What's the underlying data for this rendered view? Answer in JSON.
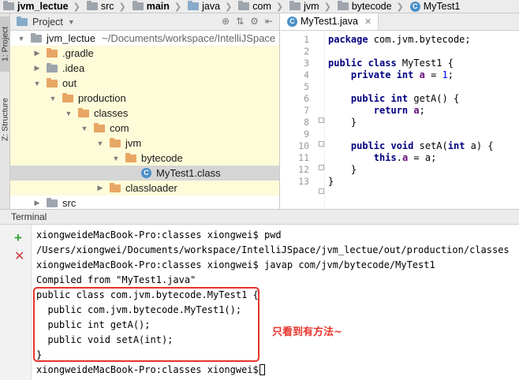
{
  "breadcrumb": {
    "items": [
      {
        "label": "jvm_lectue",
        "bold": true,
        "icon": "folder-gray-icon"
      },
      {
        "label": "src",
        "bold": false,
        "icon": "folder-gray-icon"
      },
      {
        "label": "main",
        "bold": true,
        "icon": "folder-gray-icon"
      },
      {
        "label": "java",
        "bold": false,
        "icon": "folder-blue-icon"
      },
      {
        "label": "com",
        "bold": false,
        "icon": "folder-gray-icon"
      },
      {
        "label": "jvm",
        "bold": false,
        "icon": "folder-gray-icon"
      },
      {
        "label": "bytecode",
        "bold": false,
        "icon": "folder-gray-icon"
      },
      {
        "label": "MyTest1",
        "bold": false,
        "icon": "class-icon"
      }
    ]
  },
  "toolstrip": {
    "project_tab": "1: Project",
    "structure_tab": "Z: Structure"
  },
  "project_panel": {
    "title": "Project",
    "rows": [
      {
        "indent": 0,
        "arrow": "▼",
        "icon": "folder-gray",
        "label": "jvm_lectue",
        "extra": "~/Documents/workspace/IntelliJSpace",
        "style": ""
      },
      {
        "indent": 1,
        "arrow": "▶",
        "icon": "folder-orange",
        "label": ".gradle",
        "extra": "",
        "style": "yellow"
      },
      {
        "indent": 1,
        "arrow": "▶",
        "icon": "folder-gray",
        "label": ".idea",
        "extra": "",
        "style": "yellow"
      },
      {
        "indent": 1,
        "arrow": "▼",
        "icon": "folder-orange",
        "label": "out",
        "extra": "",
        "style": "yellow"
      },
      {
        "indent": 2,
        "arrow": "▼",
        "icon": "folder-orange",
        "label": "production",
        "extra": "",
        "style": "yellow"
      },
      {
        "indent": 3,
        "arrow": "▼",
        "icon": "folder-orange",
        "label": "classes",
        "extra": "",
        "style": "yellow"
      },
      {
        "indent": 4,
        "arrow": "▼",
        "icon": "folder-orange",
        "label": "com",
        "extra": "",
        "style": "yellow"
      },
      {
        "indent": 5,
        "arrow": "▼",
        "icon": "folder-orange",
        "label": "jvm",
        "extra": "",
        "style": "yellow"
      },
      {
        "indent": 6,
        "arrow": "▼",
        "icon": "folder-orange",
        "label": "bytecode",
        "extra": "",
        "style": "yellow"
      },
      {
        "indent": 7,
        "arrow": "",
        "icon": "class",
        "label": "MyTest1.class",
        "extra": "",
        "style": "sel"
      },
      {
        "indent": 5,
        "arrow": "▶",
        "icon": "folder-orange",
        "label": "classloader",
        "extra": "",
        "style": "yellow"
      },
      {
        "indent": 1,
        "arrow": "▶",
        "icon": "folder-gray",
        "label": "src",
        "extra": "",
        "style": ""
      }
    ]
  },
  "editor": {
    "tab_label": "MyTest1.java",
    "line_numbers": [
      "1",
      "2",
      "3",
      "4",
      "5",
      "6",
      "7",
      "8",
      "9",
      "10",
      "11",
      "12",
      "13"
    ],
    "lines": [
      [
        {
          "t": "package",
          "c": "kw"
        },
        {
          "t": " com.jvm.bytecode;",
          "c": ""
        }
      ],
      [],
      [
        {
          "t": "public class",
          "c": "kw"
        },
        {
          "t": " MyTest1 {",
          "c": ""
        }
      ],
      [
        {
          "t": "    ",
          "c": ""
        },
        {
          "t": "private int",
          "c": "kw"
        },
        {
          "t": " ",
          "c": ""
        },
        {
          "t": "a",
          "c": "fld"
        },
        {
          "t": " = ",
          "c": ""
        },
        {
          "t": "1",
          "c": "num"
        },
        {
          "t": ";",
          "c": ""
        }
      ],
      [],
      [
        {
          "t": "    ",
          "c": ""
        },
        {
          "t": "public int",
          "c": "kw"
        },
        {
          "t": " getA() {",
          "c": ""
        }
      ],
      [
        {
          "t": "        ",
          "c": ""
        },
        {
          "t": "return",
          "c": "kw"
        },
        {
          "t": " ",
          "c": ""
        },
        {
          "t": "a",
          "c": "fld"
        },
        {
          "t": ";",
          "c": ""
        }
      ],
      [
        {
          "t": "    }",
          "c": ""
        }
      ],
      [],
      [
        {
          "t": "    ",
          "c": ""
        },
        {
          "t": "public void",
          "c": "kw"
        },
        {
          "t": " setA(",
          "c": ""
        },
        {
          "t": "int",
          "c": "kw"
        },
        {
          "t": " a) {",
          "c": ""
        }
      ],
      [
        {
          "t": "        ",
          "c": ""
        },
        {
          "t": "this",
          "c": "kw"
        },
        {
          "t": ".",
          "c": ""
        },
        {
          "t": "a",
          "c": "fld"
        },
        {
          "t": " = a;",
          "c": ""
        }
      ],
      [
        {
          "t": "    }",
          "c": ""
        }
      ],
      [
        {
          "t": "}",
          "c": ""
        }
      ]
    ]
  },
  "terminal": {
    "title": "Terminal",
    "lines": [
      "xiongweideMacBook-Pro:classes xiongwei$ pwd",
      "/Users/xiongwei/Documents/workspace/IntelliJSpace/jvm_lectue/out/production/classes",
      "xiongweideMacBook-Pro:classes xiongwei$ javap com/jvm/bytecode/MyTest1",
      "Compiled from \"MyTest1.java\"",
      "public class com.jvm.bytecode.MyTest1 {",
      "  public com.jvm.bytecode.MyTest1();",
      "  public int getA();",
      "  public void setA(int);",
      "}",
      "xiongweideMacBook-Pro:classes xiongwei$"
    ],
    "annotation": "只看到有方法~"
  },
  "colors": {
    "keyword": "#000080",
    "field": "#660e7a",
    "number": "#0000ff",
    "annotation": "#e8342c",
    "add_button": "#3aa53a",
    "close_button": "#d43a3a"
  }
}
